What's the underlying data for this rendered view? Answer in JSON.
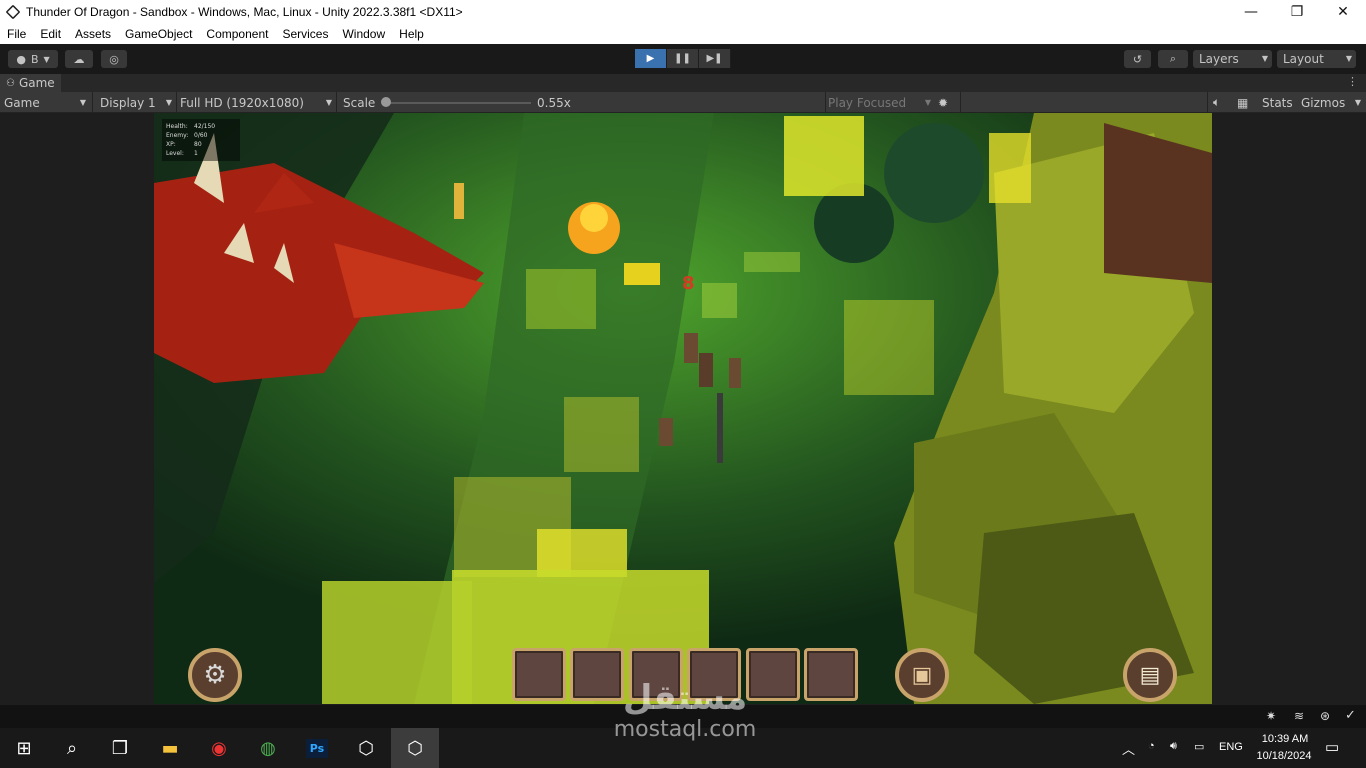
{
  "window": {
    "title": "Thunder Of Dragon - Sandbox - Windows, Mac, Linux - Unity 2022.3.38f1 <DX11>",
    "minimize": "—",
    "maximize": "❐",
    "close": "✕"
  },
  "menu": [
    "File",
    "Edit",
    "Assets",
    "GameObject",
    "Component",
    "Services",
    "Window",
    "Help"
  ],
  "toolbar": {
    "account_label": "B",
    "layers_label": "Layers",
    "layout_label": "Layout"
  },
  "tab": {
    "label": "Game"
  },
  "gamebar": {
    "view_mode": "Game",
    "display": "Display 1",
    "resolution": "Full HD (1920x1080)",
    "scale_label": "Scale",
    "scale_value": "0.55x",
    "scale_level": 0.0,
    "play_focused": "Play Focused",
    "stats": "Stats",
    "gizmos": "Gizmos"
  },
  "hud": {
    "stats": [
      {
        "label": "Health:",
        "value": "42/150"
      },
      {
        "label": "Enemy:",
        "value": "0/60"
      },
      {
        "label": "XP:",
        "value": "80"
      },
      {
        "label": "Level:",
        "value": "1"
      }
    ],
    "floating_number": "8",
    "slot_count": 6
  },
  "watermark": {
    "arabic": "مستقل",
    "latin": "mostaql.com"
  },
  "taskbar": {
    "language": "ENG",
    "time": "10:39 AM",
    "date": "10/18/2024",
    "apps": [
      "start",
      "search",
      "task-view",
      "file-explorer",
      "screen-recorder",
      "chrome",
      "photoshop",
      "unity-hub",
      "unity-editor"
    ]
  },
  "colors": {
    "play_active": "#3a72b0",
    "editor_bg": "#191919",
    "slot_border": "#c9a46a"
  }
}
